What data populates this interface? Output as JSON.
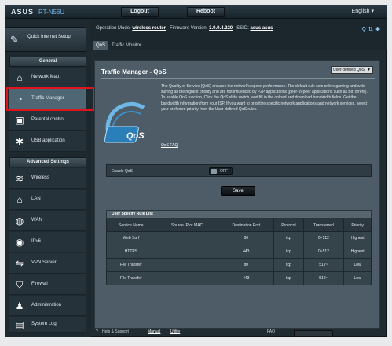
{
  "header": {
    "brand": "ASUS",
    "model": "RT-N56U",
    "logout": "Logout",
    "reboot": "Reboot",
    "language": "English"
  },
  "infobar": {
    "opmode_label": "Operation Mode:",
    "opmode_value": "wireless router",
    "firmware_label": "Firmware Version:",
    "firmware_value": "3.0.0.4.220",
    "ssid_label": "SSID:",
    "ssid_value": "asus asus"
  },
  "tabs": [
    {
      "label": "QoS"
    },
    {
      "label": "Traffic Monitor"
    }
  ],
  "sidebar": {
    "quick_setup": "Quick Internet Setup",
    "general_title": "General",
    "general_items": [
      {
        "label": "Network Map"
      },
      {
        "label": "Traffic Manager"
      },
      {
        "label": "Parental control"
      },
      {
        "label": "USB application"
      }
    ],
    "advanced_title": "Advanced Settings",
    "advanced_items": [
      {
        "label": "Wireless"
      },
      {
        "label": "LAN"
      },
      {
        "label": "WAN"
      },
      {
        "label": "IPv6"
      },
      {
        "label": "VPN Server"
      },
      {
        "label": "Firewall"
      },
      {
        "label": "Administration"
      },
      {
        "label": "System Log"
      }
    ]
  },
  "main": {
    "title": "Traffic Manager - QoS",
    "select_value": "User-defined QoS",
    "gauge_text": "QoS",
    "description": "The Quality of Service (QoS) ensures the network's speed performance. The default rule sets online gaming and web surfing as the highest priority and are not influenced by P2P applications (peer-to-peer applications such as BitTorrent). To enable QoS function, Click the QoS slide switch, and fill in the upload and download bandwidth fields. Get the bandwidth information from your ISP. If you want to prioritize specific network applications and network services, select your preferred priority from the User-defined QoS rules.",
    "faq": "QoS FAQ",
    "enable_label": "Enable QoS",
    "toggle_text": "OFF",
    "apply": "Save",
    "table_title": "User Specify Rule List",
    "columns": [
      "Service Name",
      "Source IP or MAC",
      "Destination Port",
      "Protocol",
      "Transferred",
      "Priority"
    ],
    "rows": [
      [
        "Web Surf",
        "",
        "80",
        "tcp",
        "0~512",
        "Highest"
      ],
      [
        "HTTPS",
        "",
        "443",
        "tcp",
        "0~512",
        "Highest"
      ],
      [
        "File Transfer",
        "",
        "80",
        "tcp",
        "512~",
        "Low"
      ],
      [
        "File Transfer",
        "",
        "443",
        "tcp",
        "512~",
        "Low"
      ]
    ]
  },
  "footer": {
    "help": "Help & Support",
    "manual": "Manual",
    "utility": "Utility",
    "faq": "FAQ"
  }
}
